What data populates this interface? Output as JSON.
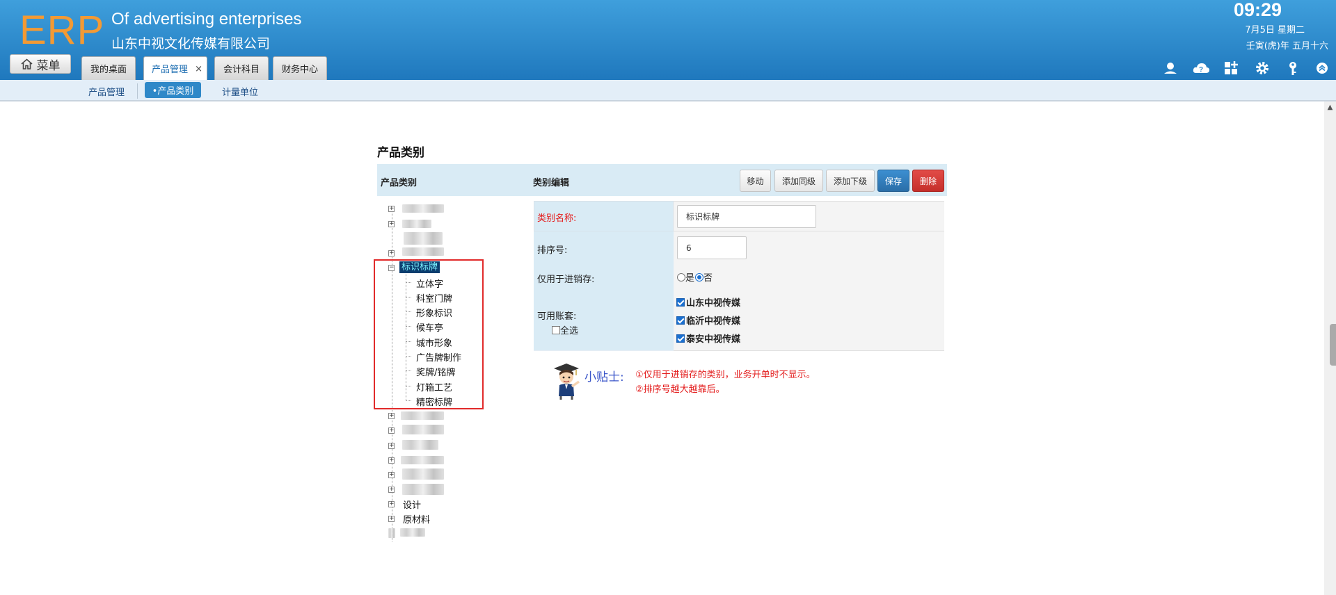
{
  "header": {
    "logo": "ERP",
    "company_en": "Of advertising enterprises",
    "company_cn": "山东中视文化传媒有限公司",
    "time": "09:29",
    "date": "7月5日 星期二",
    "lunar": "壬寅(虎)年 五月十六",
    "menu_label": "菜单",
    "tabs": [
      {
        "label": "我的桌面"
      },
      {
        "label": "产品管理",
        "closable": "×"
      },
      {
        "label": "会计科目"
      },
      {
        "label": "财务中心"
      }
    ],
    "icons": [
      "user-icon",
      "cloud-help-icon",
      "grid-add-icon",
      "gear-icon",
      "key-icon",
      "collapse-up-icon"
    ]
  },
  "subnav": {
    "items": [
      "产品管理",
      "•产品类别",
      "计量单位"
    ]
  },
  "page": {
    "title": "产品类别",
    "left_header": "产品类别",
    "right_header": "类别编辑",
    "buttons": {
      "move": "移动",
      "add_sibling": "添加同级",
      "add_child": "添加下级",
      "save": "保存",
      "delete": "删除"
    }
  },
  "tree": {
    "selected": "标识标牌",
    "children": [
      "立体字",
      "科室门牌",
      "形象标识",
      "候车亭",
      "城市形象",
      "广告牌制作",
      "奖牌/铭牌",
      "灯箱工艺",
      "精密标牌"
    ],
    "visible_roots": [
      "设计",
      "原材料"
    ]
  },
  "form": {
    "name_label": "类别名称:",
    "name_value": "标识标牌",
    "sort_label": "排序号:",
    "sort_value": "6",
    "inventory_label": "仅用于进销存:",
    "inventory_yes": "是",
    "inventory_no": "否",
    "inventory_selected": "否",
    "accounts_label": "可用账套:",
    "select_all": "全选",
    "accounts": [
      "山东中视传媒",
      "临沂中视传媒",
      "泰安中视传媒"
    ]
  },
  "tips": {
    "title": "小贴士:",
    "lines": [
      "①仅用于进销存的类别，业务开单时不显示。",
      "②排序号越大越靠后。"
    ]
  },
  "colors": {
    "header_blue": "#2a86cc",
    "logo_orange": "#f39a34",
    "save_blue": "#2a6ea8",
    "delete_red": "#d13a36",
    "highlight_red": "#e12a2a",
    "required_red": "#e51c1c"
  }
}
